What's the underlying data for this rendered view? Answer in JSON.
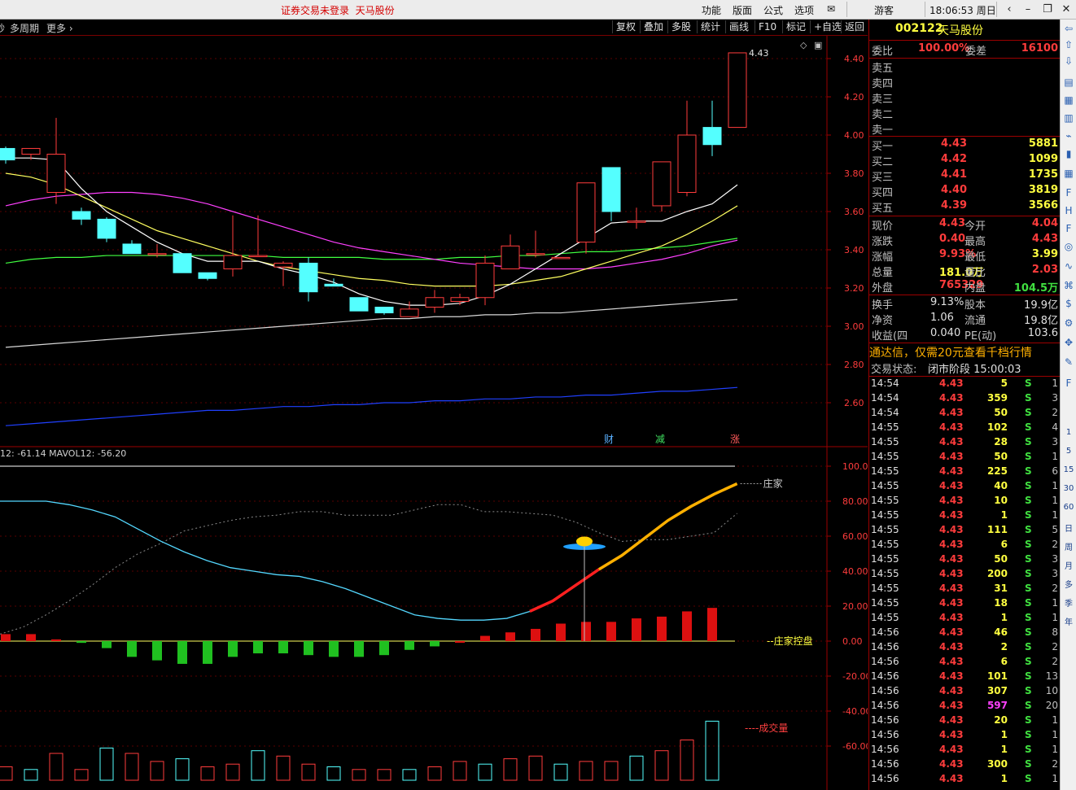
{
  "titlebar": {
    "status": "证券交易未登录",
    "name": "天马股份",
    "menus": [
      "功能",
      "版面",
      "公式",
      "选项"
    ],
    "user": "游客",
    "time": "18:06:53",
    "weekday": "周日"
  },
  "toolbar": {
    "left_items": [
      "秒",
      "多周期",
      "更多 ›"
    ],
    "buttons": [
      "复权",
      "叠加",
      "多股",
      "统计",
      "画线",
      "F10",
      "标记",
      "+自选",
      "返回"
    ]
  },
  "main_chart": {
    "price_ticks": [
      "4.40",
      "4.20",
      "4.00",
      "3.80",
      "3.60",
      "3.40",
      "3.20",
      "3.00",
      "2.80",
      "2.60"
    ],
    "last_label": "4.43",
    "event_markers": [
      {
        "text": "财",
        "color": "#5ab0ff"
      },
      {
        "text": "减",
        "color": "#40e060"
      },
      {
        "text": "涨",
        "color": "#ff5a5a"
      }
    ],
    "candles_ohlc": [
      [
        3.93,
        3.87,
        3.94,
        3.85
      ],
      [
        3.9,
        3.93,
        3.93,
        3.87
      ],
      [
        3.7,
        3.9,
        4.09,
        3.64
      ],
      [
        3.6,
        3.56,
        3.62,
        3.53
      ],
      [
        3.56,
        3.46,
        3.57,
        3.44
      ],
      [
        3.43,
        3.38,
        3.45,
        3.38
      ],
      [
        3.38,
        3.38,
        3.43,
        3.36
      ],
      [
        3.38,
        3.28,
        3.38,
        3.28
      ],
      [
        3.28,
        3.25,
        3.28,
        3.24
      ],
      [
        3.3,
        3.37,
        3.58,
        3.26
      ],
      [
        3.37,
        3.37,
        3.58,
        3.37
      ],
      [
        3.31,
        3.33,
        3.34,
        3.21
      ],
      [
        3.33,
        3.18,
        3.36,
        3.13
      ],
      [
        3.22,
        3.21,
        3.25,
        3.21
      ],
      [
        3.15,
        3.08,
        3.15,
        3.08
      ],
      [
        3.1,
        3.07,
        3.1,
        3.06
      ],
      [
        3.05,
        3.09,
        3.13,
        3.05
      ],
      [
        3.1,
        3.15,
        3.19,
        3.07
      ],
      [
        3.13,
        3.15,
        3.17,
        3.11
      ],
      [
        3.15,
        3.33,
        3.37,
        3.11
      ],
      [
        3.3,
        3.42,
        3.48,
        3.3
      ],
      [
        3.38,
        3.38,
        3.5,
        3.36
      ],
      [
        3.36,
        3.36,
        3.36,
        3.36
      ],
      [
        3.44,
        3.75,
        3.75,
        3.38
      ],
      [
        3.83,
        3.6,
        3.83,
        3.55
      ],
      [
        3.55,
        3.55,
        3.62,
        3.51
      ],
      [
        3.63,
        3.86,
        3.86,
        3.6
      ],
      [
        3.7,
        4.0,
        4.18,
        3.68
      ],
      [
        4.04,
        3.95,
        4.18,
        3.89
      ],
      [
        4.04,
        4.43,
        4.43,
        4.04
      ]
    ],
    "ma5": [
      3.88,
      3.88,
      3.87,
      3.72,
      3.6,
      3.52,
      3.44,
      3.38,
      3.34,
      3.34,
      3.34,
      3.3,
      3.27,
      3.23,
      3.17,
      3.13,
      3.11,
      3.11,
      3.12,
      3.16,
      3.22,
      3.3,
      3.38,
      3.46,
      3.54,
      3.55,
      3.55,
      3.6,
      3.64,
      3.74
    ],
    "ma10": [
      3.8,
      3.78,
      3.74,
      3.68,
      3.62,
      3.56,
      3.5,
      3.46,
      3.42,
      3.38,
      3.34,
      3.31,
      3.29,
      3.27,
      3.25,
      3.24,
      3.22,
      3.21,
      3.21,
      3.21,
      3.22,
      3.24,
      3.26,
      3.3,
      3.34,
      3.38,
      3.42,
      3.48,
      3.55,
      3.63
    ],
    "ma30": [
      3.63,
      3.66,
      3.68,
      3.69,
      3.7,
      3.7,
      3.69,
      3.67,
      3.64,
      3.6,
      3.56,
      3.52,
      3.48,
      3.44,
      3.41,
      3.39,
      3.37,
      3.35,
      3.33,
      3.32,
      3.31,
      3.3,
      3.3,
      3.3,
      3.31,
      3.33,
      3.35,
      3.38,
      3.42,
      3.45
    ],
    "ma60": [
      3.33,
      3.35,
      3.36,
      3.36,
      3.37,
      3.37,
      3.37,
      3.37,
      3.37,
      3.37,
      3.37,
      3.36,
      3.36,
      3.36,
      3.36,
      3.35,
      3.35,
      3.35,
      3.36,
      3.36,
      3.37,
      3.37,
      3.38,
      3.39,
      3.39,
      3.4,
      3.41,
      3.42,
      3.44,
      3.46
    ],
    "ma120": [
      2.89,
      2.9,
      2.91,
      2.92,
      2.93,
      2.94,
      2.95,
      2.96,
      2.97,
      2.98,
      2.99,
      3.0,
      3.01,
      3.02,
      3.03,
      3.04,
      3.04,
      3.05,
      3.05,
      3.06,
      3.06,
      3.07,
      3.07,
      3.08,
      3.09,
      3.1,
      3.11,
      3.12,
      3.13,
      3.14
    ],
    "ma250": [
      2.48,
      2.49,
      2.5,
      2.51,
      2.52,
      2.53,
      2.54,
      2.55,
      2.56,
      2.56,
      2.57,
      2.58,
      2.58,
      2.59,
      2.59,
      2.6,
      2.6,
      2.61,
      2.61,
      2.62,
      2.62,
      2.63,
      2.63,
      2.64,
      2.64,
      2.65,
      2.66,
      2.66,
      2.67,
      2.68
    ]
  },
  "sub_chart": {
    "legend": "12: -61.14  MAVOL12: -56.20",
    "y_ticks": [
      "100.0",
      "80.00",
      "60.00",
      "40.00",
      "20.00",
      "0.00",
      "-20.00",
      "-40.00",
      "-60.00"
    ],
    "label_zhuangjia": "庄家",
    "label_kongpan": "庄家控盘",
    "label_volume": "成交量",
    "cyan_line": [
      80,
      80,
      80,
      78,
      75,
      71,
      64,
      57,
      51,
      46,
      42,
      40,
      38,
      37,
      34,
      30,
      25,
      20,
      15,
      13,
      12,
      12,
      13,
      17,
      23,
      32,
      41,
      49,
      59,
      69,
      77,
      84,
      90
    ],
    "dashed_line": [
      4,
      8,
      15,
      23,
      32,
      42,
      50,
      56,
      63,
      66,
      69,
      71,
      72,
      74,
      74,
      72,
      72,
      72,
      75,
      78,
      78,
      74,
      74,
      73,
      72,
      68,
      62,
      57,
      58,
      58,
      60,
      62,
      73
    ],
    "control_bars": [
      [
        4
      ],
      [
        4
      ],
      [
        1
      ],
      [
        -1
      ],
      [
        -4
      ],
      [
        -9
      ],
      [
        -11
      ],
      [
        -13
      ],
      [
        -13
      ],
      [
        -9
      ],
      [
        -7
      ],
      [
        -7
      ],
      [
        -8
      ],
      [
        -9
      ],
      [
        -9
      ],
      [
        -8
      ],
      [
        -5
      ],
      [
        -3
      ],
      [
        0
      ],
      [
        3
      ],
      [
        5
      ],
      [
        7
      ],
      [
        10
      ],
      [
        11
      ],
      [
        11
      ],
      [
        13
      ],
      [
        14
      ],
      [
        17
      ],
      [
        19
      ]
    ],
    "volume_bars": [
      5,
      4,
      10,
      4,
      12,
      10,
      7,
      8,
      5,
      6,
      11,
      9,
      6,
      5,
      4,
      4,
      4,
      5,
      7,
      6,
      8,
      9,
      6,
      7,
      7,
      9,
      11,
      15,
      22
    ]
  },
  "quote": {
    "code": "002122",
    "name": "天马股份",
    "weibi_label": "委比",
    "weibi": "100.00%",
    "weicha_label": "委差",
    "weicha": "16100",
    "sells": [
      "卖五",
      "卖四",
      "卖三",
      "卖二",
      "卖一"
    ],
    "buys": [
      {
        "label": "买一",
        "price": "4.43",
        "vol": "5881"
      },
      {
        "label": "买二",
        "price": "4.42",
        "vol": "1099"
      },
      {
        "label": "买三",
        "price": "4.41",
        "vol": "1735"
      },
      {
        "label": "买四",
        "price": "4.40",
        "vol": "3819"
      },
      {
        "label": "买五",
        "price": "4.39",
        "vol": "3566"
      }
    ],
    "stats": [
      {
        "l1": "现价",
        "v1": "4.43",
        "c1": "#ff3c3c",
        "l2": "今开",
        "v2": "4.04",
        "c2": "#ff3c3c"
      },
      {
        "l1": "涨跌",
        "v1": "0.40",
        "c1": "#ff3c3c",
        "l2": "最高",
        "v2": "4.43",
        "c2": "#ff3c3c"
      },
      {
        "l1": "涨幅",
        "v1": "9.93%",
        "c1": "#ff3c3c",
        "l2": "最低",
        "v2": "3.99",
        "c2": "#ffff40"
      },
      {
        "l1": "总量",
        "v1": "181.0万",
        "c1": "#ffff40",
        "l2": "量比",
        "v2": "2.03",
        "c2": "#ff3c3c"
      },
      {
        "l1": "外盘",
        "v1": "765329",
        "c1": "#ff3c3c",
        "l2": "内盘",
        "v2": "104.5万",
        "c2": "#40e040"
      }
    ],
    "fund": [
      {
        "l1": "换手",
        "v1": "9.13%",
        "l2": "股本",
        "v2": "19.9亿"
      },
      {
        "l1": "净资",
        "v1": "1.06",
        "l2": "流通",
        "v2": "19.8亿"
      },
      {
        "l1": "收益(四",
        "v1": "0.040",
        "l2": "PE(动)",
        "v2": "103.6"
      }
    ],
    "promo": "通达信，仅需20元查看千档行情",
    "trade_status_label": "交易状态:",
    "trade_status": "闭市阶段 15:00:03",
    "ticks": [
      {
        "t": "14:54",
        "p": "4.43",
        "v": "5",
        "n": "1"
      },
      {
        "t": "14:54",
        "p": "4.43",
        "v": "359",
        "n": "3"
      },
      {
        "t": "14:54",
        "p": "4.43",
        "v": "50",
        "n": "2"
      },
      {
        "t": "14:55",
        "p": "4.43",
        "v": "102",
        "n": "4"
      },
      {
        "t": "14:55",
        "p": "4.43",
        "v": "28",
        "n": "3"
      },
      {
        "t": "14:55",
        "p": "4.43",
        "v": "50",
        "n": "1"
      },
      {
        "t": "14:55",
        "p": "4.43",
        "v": "225",
        "n": "6"
      },
      {
        "t": "14:55",
        "p": "4.43",
        "v": "40",
        "n": "1"
      },
      {
        "t": "14:55",
        "p": "4.43",
        "v": "10",
        "n": "1"
      },
      {
        "t": "14:55",
        "p": "4.43",
        "v": "1",
        "n": "1"
      },
      {
        "t": "14:55",
        "p": "4.43",
        "v": "111",
        "n": "5"
      },
      {
        "t": "14:55",
        "p": "4.43",
        "v": "6",
        "n": "2"
      },
      {
        "t": "14:55",
        "p": "4.43",
        "v": "50",
        "n": "3"
      },
      {
        "t": "14:55",
        "p": "4.43",
        "v": "200",
        "n": "3"
      },
      {
        "t": "14:55",
        "p": "4.43",
        "v": "31",
        "n": "2"
      },
      {
        "t": "14:55",
        "p": "4.43",
        "v": "18",
        "n": "1"
      },
      {
        "t": "14:55",
        "p": "4.43",
        "v": "1",
        "n": "1"
      },
      {
        "t": "14:56",
        "p": "4.43",
        "v": "46",
        "n": "8"
      },
      {
        "t": "14:56",
        "p": "4.43",
        "v": "2",
        "n": "2"
      },
      {
        "t": "14:56",
        "p": "4.43",
        "v": "6",
        "n": "2"
      },
      {
        "t": "14:56",
        "p": "4.43",
        "v": "101",
        "n": "13"
      },
      {
        "t": "14:56",
        "p": "4.43",
        "v": "307",
        "n": "10"
      },
      {
        "t": "14:56",
        "p": "4.43",
        "v": "597",
        "n": "20"
      },
      {
        "t": "14:56",
        "p": "4.43",
        "v": "20",
        "n": "1"
      },
      {
        "t": "14:56",
        "p": "4.43",
        "v": "1",
        "n": "1"
      },
      {
        "t": "14:56",
        "p": "4.43",
        "v": "1",
        "n": "1"
      },
      {
        "t": "14:56",
        "p": "4.43",
        "v": "300",
        "n": "2"
      },
      {
        "t": "14:56",
        "p": "4.43",
        "v": "1",
        "n": "1"
      }
    ],
    "tick_side": "S"
  },
  "sidebar": {
    "periods": [
      "1",
      "5",
      "15",
      "30",
      "60",
      "日",
      "周",
      "月",
      "多",
      "季",
      "年"
    ],
    "icons": [
      "arrow-left-icon",
      "arrow-up-icon",
      "arrow-down-icon",
      "report-icon",
      "table-icon",
      "list-icon",
      "line-chart-icon",
      "candle-icon",
      "grid-icon",
      "f10-icon",
      "fh-icon",
      "fz-icon",
      "circle-icon",
      "wave-icon",
      "rss-icon",
      "money-icon",
      "gear-icon",
      "move-icon",
      "pen-icon",
      "f5-icon"
    ]
  },
  "colors": {
    "up": "#ff3c3c",
    "down": "#54ffff",
    "ma5": "#ffffff",
    "ma10": "#ffff60",
    "ma30": "#ff40ff",
    "ma60": "#40ff40",
    "ma120": "#d8d8d8",
    "ma250": "#2040ff",
    "axis": "#9c0000"
  }
}
